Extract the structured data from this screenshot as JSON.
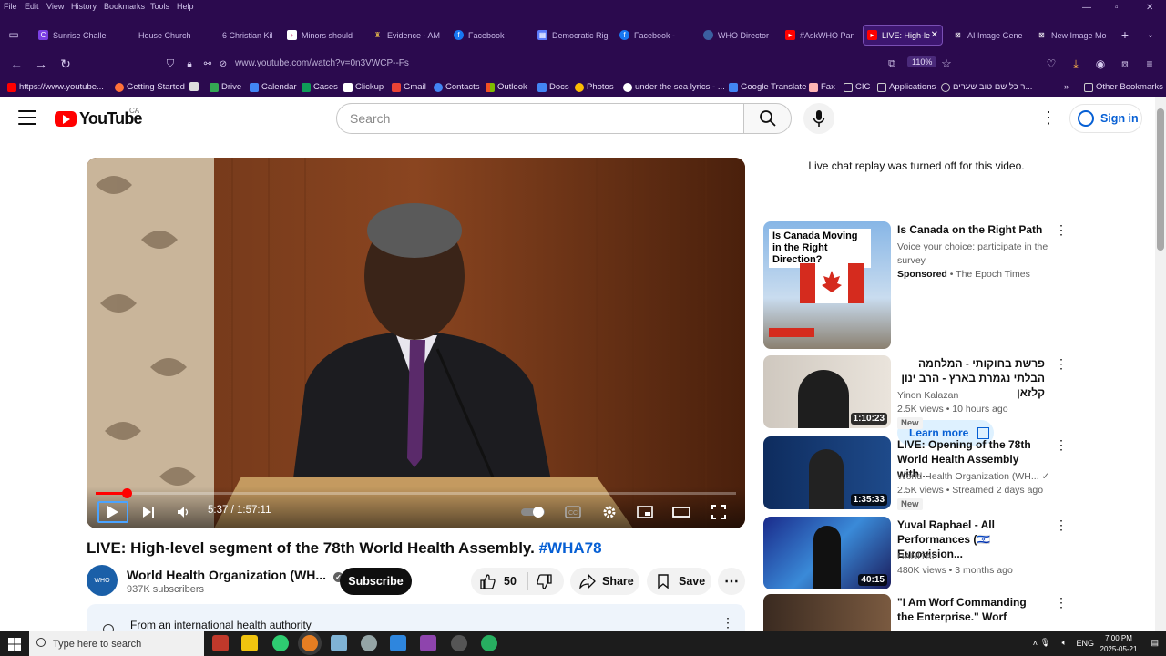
{
  "browser": {
    "menu": [
      "File",
      "Edit",
      "View",
      "History",
      "Bookmarks",
      "Tools",
      "Help"
    ],
    "tabs": [
      {
        "label": "Sunrise Challe",
        "fav": "C",
        "color": "#7b3fe4"
      },
      {
        "label": "House Church",
        "fav": "",
        "color": "#2e1b55"
      },
      {
        "label": "6 Christian Kil",
        "fav": "",
        "color": "#2e1b55"
      },
      {
        "label": "Minors should",
        "fav": "",
        "color": "#c2185b"
      },
      {
        "label": "Evidence - AM",
        "fav": "",
        "color": "#8a6d3b"
      },
      {
        "label": "Facebook",
        "fav": "f",
        "color": "#1877f2"
      },
      {
        "label": "Democratic Rig",
        "fav": "",
        "color": "#5c7cfa"
      },
      {
        "label": "Facebook -",
        "fav": "f",
        "color": "#1877f2"
      },
      {
        "label": "WHO Director",
        "fav": "",
        "color": "#3b5fa0"
      },
      {
        "label": "#AskWHO Pan",
        "fav": "",
        "color": "#ff0000"
      },
      {
        "label": "LIVE: High-le",
        "fav": "",
        "color": "#ff0000"
      },
      {
        "label": "AI Image Gene",
        "fav": "",
        "color": "#ffffff"
      },
      {
        "label": "New Image Mo",
        "fav": "",
        "color": "#ffffff"
      }
    ],
    "url": "www.youtube.com/watch?v=0n3VWCP--Fs",
    "zoom": "110%",
    "bookmarks": [
      {
        "label": "https://www.youtube...",
        "color": "#ff0000"
      },
      {
        "label": "Getting Started",
        "color": "#ff7139"
      },
      {
        "label": "",
        "color": "#ddd"
      },
      {
        "label": "Drive",
        "color": "#34a853"
      },
      {
        "label": "Calendar",
        "color": "#4285f4"
      },
      {
        "label": "Cases",
        "color": "#0f9d58"
      },
      {
        "label": "Clickup",
        "color": "#7b68ee"
      },
      {
        "label": "Gmail",
        "color": "#ea4335"
      },
      {
        "label": "Contacts",
        "color": "#4285f4"
      },
      {
        "label": "Outlook",
        "color": "#0078d4"
      },
      {
        "label": "Docs",
        "color": "#4285f4"
      },
      {
        "label": "Photos",
        "color": "#fbbc04"
      },
      {
        "label": "under the sea lyrics - ...",
        "color": "#fff"
      },
      {
        "label": "Google Translate",
        "color": "#4285f4"
      },
      {
        "label": "Fax",
        "color": "#ffb4b4"
      },
      {
        "label": "CIC",
        "color": "#ccc"
      },
      {
        "label": "Applications",
        "color": "#ccc"
      },
      {
        "label": "ר כל שם טוב שערים...",
        "color": "#ccc"
      },
      {
        "label": "Other Bookmarks",
        "color": "#ccc"
      }
    ]
  },
  "youtube": {
    "logo_text": "YouTube",
    "country": "CA",
    "search_placeholder": "Search",
    "signin_label": "Sign in",
    "player": {
      "time_current": "5:37",
      "time_total": "1:57:11",
      "progress_fraction": 0.048
    },
    "video": {
      "title": "LIVE: High-level segment of the 78th World Health Assembly.",
      "hashtag": "#WHA78",
      "channel": "World Health Organization (WH...",
      "subscribers": "937K subscribers",
      "subscribe_label": "Subscribe",
      "likes": "50",
      "share_label": "Share",
      "save_label": "Save",
      "description": "From an international health authority"
    },
    "live_chat_message": "Live chat replay was turned off for this video.",
    "recommendations": [
      {
        "title": "Is Canada on the Right Path",
        "meta1": "Voice your choice: participate in the survey",
        "meta2_bold": "Sponsored",
        "meta2": "The Epoch Times",
        "cta": "Learn more",
        "thumb_text": "Is Canada Moving in the Right Direction?",
        "duration": ""
      },
      {
        "title": "פרשת בחוקותי - המלחמה הבלתי נגמרת בארץ - הרב ינון קלזאן",
        "meta1": "Yinon Kalazan",
        "meta2": "2.5K views • 10 hours ago",
        "badge": "New",
        "duration": "1:10:23"
      },
      {
        "title": "LIVE: Opening of the 78th World Health Assembly with...",
        "meta1": "World Health Organization (WH...",
        "meta2": "2.5K views • Streamed 2 days ago",
        "badge": "New",
        "duration": "1:35:33"
      },
      {
        "title": "Yuval Raphael - All Performances (🇮🇱 Eurovision...",
        "meta1": "HANITAI",
        "meta2": "480K views • 3 months ago",
        "duration": "40:15"
      },
      {
        "title": "\"I Am Worf Commanding the Enterprise.\" Worf",
        "meta1": "",
        "meta2": "",
        "duration": ""
      }
    ]
  },
  "taskbar": {
    "search_placeholder": "Type here to search",
    "lang": "ENG",
    "time": "7:00 PM",
    "date": "2025-05-21"
  }
}
